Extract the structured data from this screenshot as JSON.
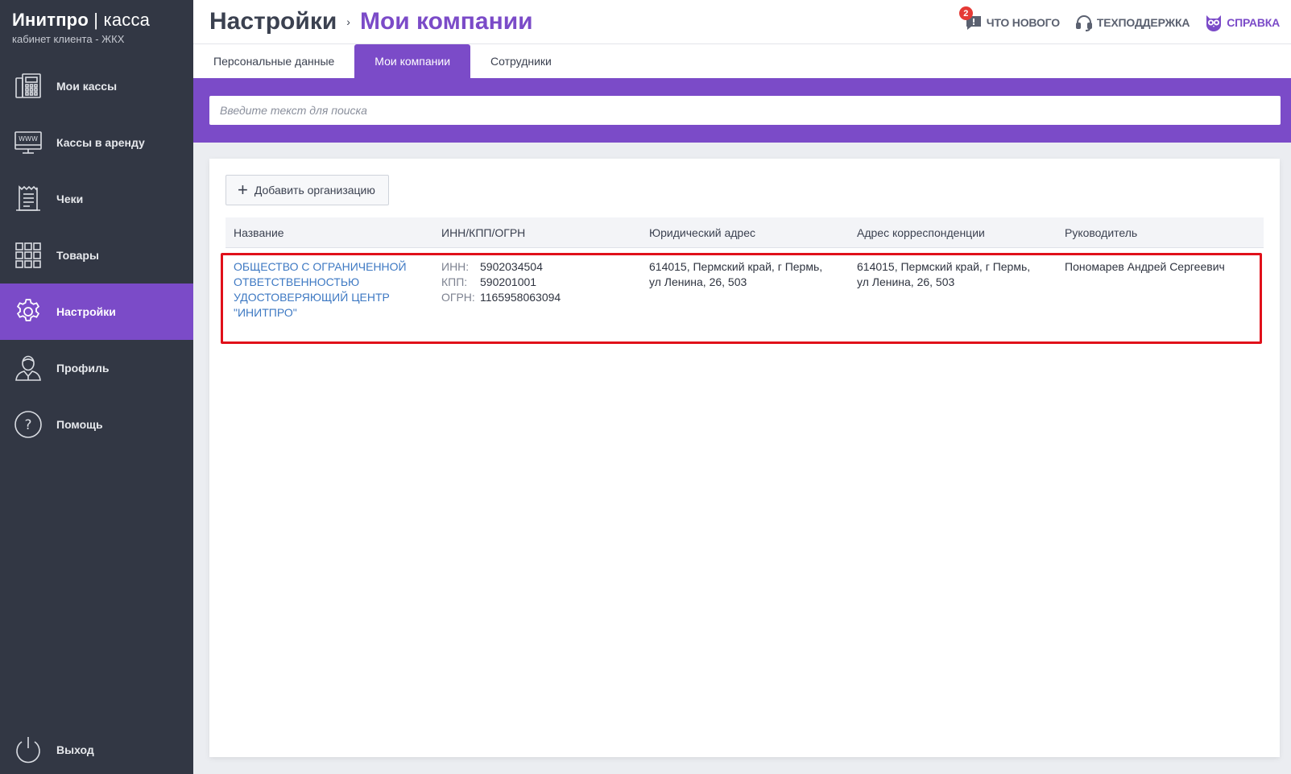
{
  "brand": {
    "title_main": "Инитпро",
    "title_sep": " | ",
    "title_rest": "касса",
    "subtitle": "кабинет клиента - ЖКХ"
  },
  "sidebar": {
    "items": [
      {
        "label": "Мои кассы",
        "icon": "cash-register-icon"
      },
      {
        "label": "Кассы в аренду",
        "icon": "www-monitor-icon"
      },
      {
        "label": "Чеки",
        "icon": "receipt-icon"
      },
      {
        "label": "Товары",
        "icon": "grid-icon"
      },
      {
        "label": "Настройки",
        "icon": "gear-icon",
        "active": true
      },
      {
        "label": "Профиль",
        "icon": "user-icon"
      },
      {
        "label": "Помощь",
        "icon": "question-icon"
      }
    ],
    "exit_label": "Выход"
  },
  "header": {
    "breadcrumb_root": "Настройки",
    "breadcrumb_sep": "›",
    "breadcrumb_current": "Мои компании",
    "whats_new": {
      "label": "ЧТО НОВОГО",
      "badge": "2"
    },
    "support_label": "ТЕХПОДДЕРЖКА",
    "help_label": "СПРАВКА"
  },
  "tabs": [
    {
      "label": "Персональные данные"
    },
    {
      "label": "Мои компании",
      "active": true
    },
    {
      "label": "Сотрудники"
    }
  ],
  "search": {
    "placeholder": "Введите текст для поиска",
    "value": ""
  },
  "toolbar": {
    "add_label": "Добавить организацию"
  },
  "table": {
    "columns": [
      "Название",
      "ИНН/КПП/ОГРН",
      "Юридический адрес",
      "Адрес корреспонденции",
      "Руководитель"
    ],
    "rows": [
      {
        "name_lines": [
          "ОБЩЕСТВО С ОГРАНИЧЕННОЙ",
          "ОТВЕТСТВЕННОСТЬЮ",
          "УДОСТОВЕРЯЮЩИЙ ЦЕНТР",
          "\"ИНИТПРО\""
        ],
        "inn_label": "ИНН:",
        "inn": "5902034504",
        "kpp_label": "КПП:",
        "kpp": "590201001",
        "ogrn_label": "ОГРН:",
        "ogrn": "1165958063094",
        "legal_address_lines": [
          "614015, Пермский край, г Пермь,",
          "ул Ленина, 26, 503"
        ],
        "mail_address_lines": [
          "614015, Пермский край, г Пермь,",
          "ул Ленина, 26, 503"
        ],
        "director": "Пономарев Андрей Сергеевич"
      }
    ]
  },
  "colors": {
    "accent": "#7b4bc8",
    "sidebar": "#323744",
    "link": "#3e79c3",
    "highlight": "#e0101a",
    "badge": "#e53935"
  }
}
